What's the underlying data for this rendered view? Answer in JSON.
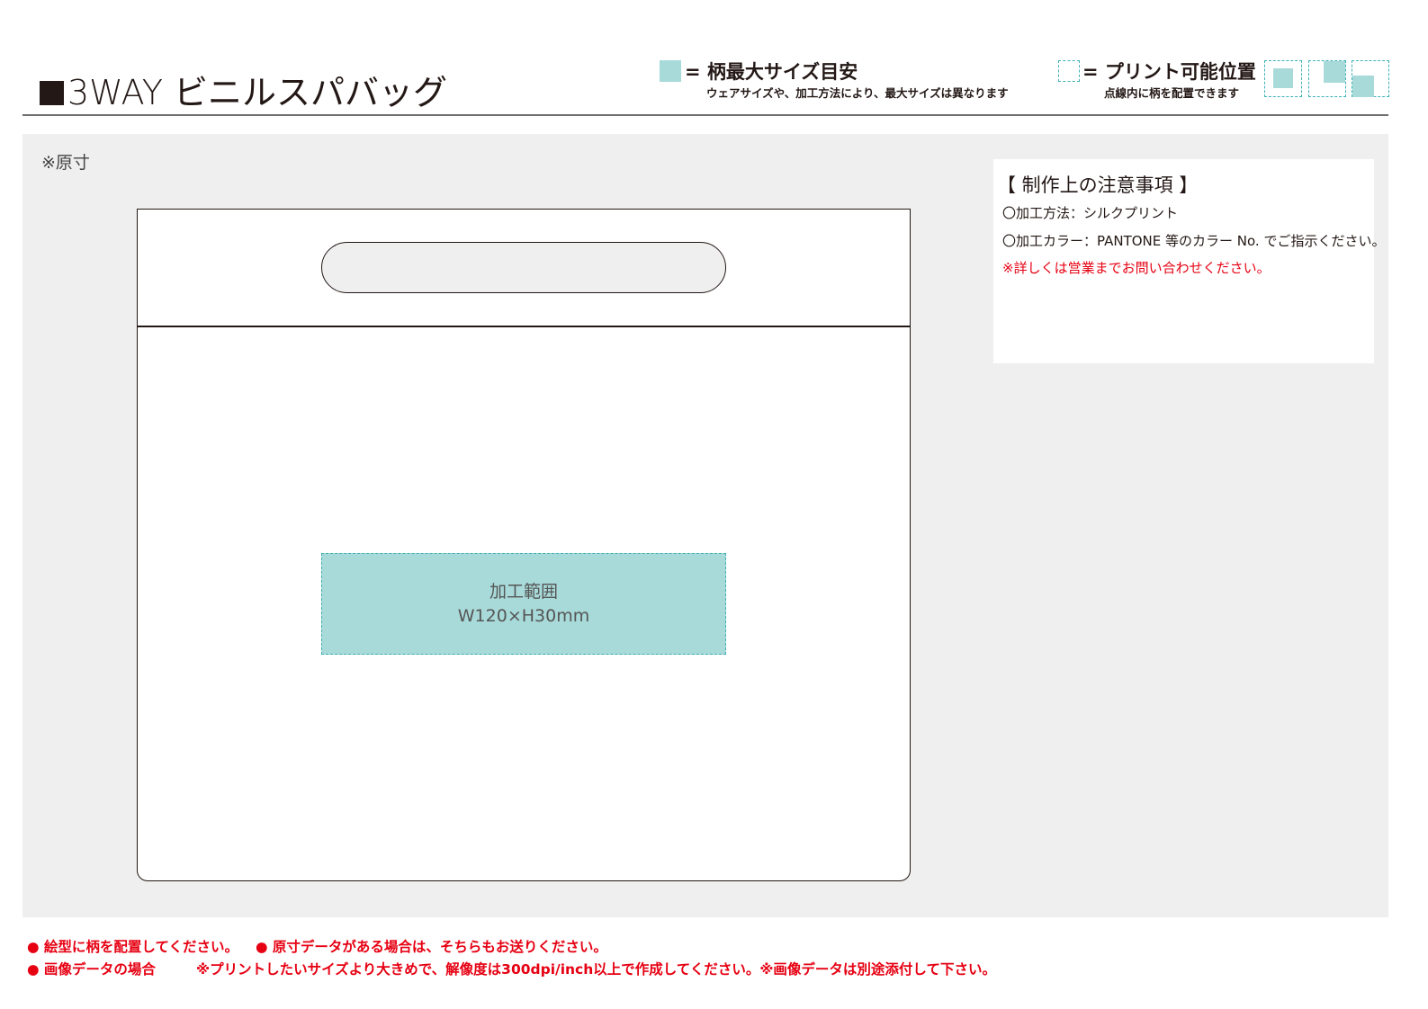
{
  "header": {
    "title": "3WAY ビニルスパバッグ",
    "legend_max_size": {
      "title": "= 柄最大サイズ目安",
      "note": "ウェアサイズや、加工方法により、最大サイズは異なります"
    },
    "legend_print_position": {
      "title": "= プリント可能位置",
      "note": "点線内に柄を配置できます"
    }
  },
  "work_area": {
    "scale_note": "※原寸",
    "print_area": {
      "label": "加工範囲",
      "size": "W120×H30mm"
    }
  },
  "notes": {
    "title": "【 制作上の注意事項 】",
    "method": "〇加工方法：シルクプリント",
    "color": "〇加工カラー：PANTONE 等のカラー No. でご指示ください。",
    "contact": "※詳しくは営業までお問い合わせください。"
  },
  "footer": {
    "line1_a": "● 絵型に柄を配置してください。",
    "line1_b": "● 原寸データがある場合は、そちらもお送りください。",
    "line2_a": "● 画像データの場合",
    "line2_b": "※プリントしたいサイズより大きめで、解像度は300dpi/inch以上で作成してください。※画像データは別途添付して下さい。"
  },
  "colors": {
    "accent_teal": "#a8dad9",
    "dash_teal": "#3fb1b4",
    "warning_red": "#e60012",
    "panel_gray": "#eeefee"
  }
}
